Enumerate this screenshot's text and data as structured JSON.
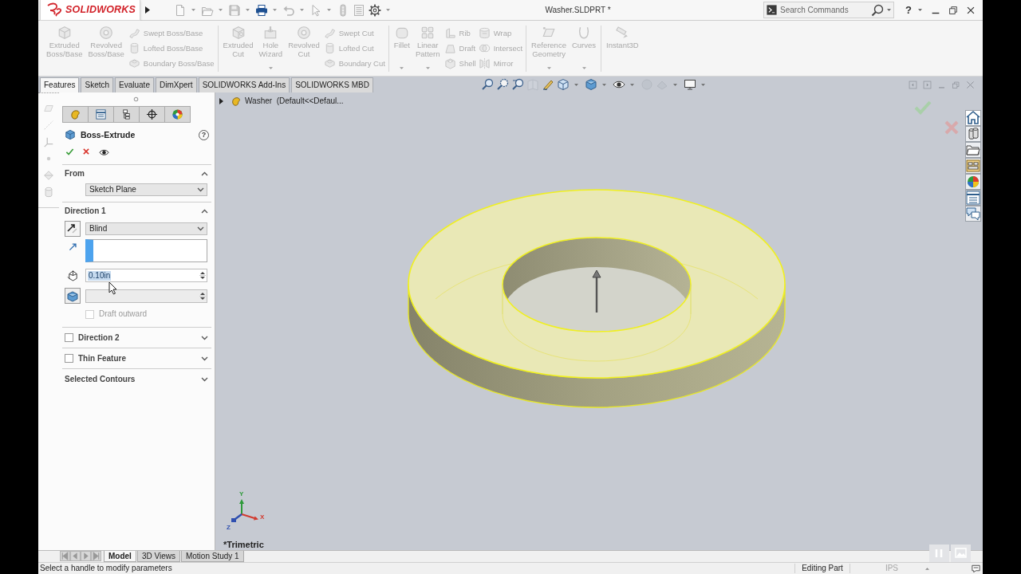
{
  "title_bar": {
    "logo": "**SOLID**WORKS",
    "document": "Washer.SLDPRT *",
    "search": {
      "placeholder": "Search Commands"
    },
    "help": "?"
  },
  "ribbon": {
    "disabled": true,
    "groups": [
      {
        "columns": [
          {
            "kind": "large",
            "label": "Extruded Boss/Base",
            "menu": false
          },
          {
            "kind": "large",
            "label": "Revolved Boss/Base",
            "menu": false
          },
          {
            "kind": "stack",
            "items": [
              "Swept Boss/Base",
              "Lofted Boss/Base",
              "Boundary Boss/Base"
            ]
          }
        ]
      },
      {
        "columns": [
          {
            "kind": "large",
            "label": "Extruded Cut",
            "menu": false
          },
          {
            "kind": "large",
            "label": "Hole Wizard",
            "menu": true
          },
          {
            "kind": "large",
            "label": "Revolved Cut",
            "menu": false
          },
          {
            "kind": "stack",
            "items": [
              "Swept Cut",
              "Lofted Cut",
              "Boundary Cut"
            ]
          }
        ]
      },
      {
        "columns": [
          {
            "kind": "large",
            "label": "Fillet",
            "menu": true
          },
          {
            "kind": "large",
            "label": "Linear Pattern",
            "menu": true
          },
          {
            "kind": "stack",
            "items": [
              "Rib",
              "Draft",
              "Shell"
            ]
          },
          {
            "kind": "stack",
            "items": [
              "Wrap",
              "Intersect",
              "Mirror"
            ]
          }
        ]
      },
      {
        "columns": [
          {
            "kind": "large",
            "label": "Reference Geometry",
            "menu": true
          },
          {
            "kind": "large",
            "label": "Curves",
            "menu": true
          }
        ]
      },
      {
        "columns": [
          {
            "kind": "large",
            "label": "Instant3D",
            "menu": false
          }
        ]
      }
    ]
  },
  "command_tabs": [
    {
      "label": "Features",
      "selected": true
    },
    {
      "label": "Sketch",
      "selected": false
    },
    {
      "label": "Evaluate",
      "selected": false
    },
    {
      "label": "DimXpert",
      "selected": false
    },
    {
      "label": "SOLIDWORKS Add-Ins",
      "selected": false
    },
    {
      "label": "SOLIDWORKS MBD",
      "selected": false
    }
  ],
  "property_manager": {
    "title": "Boss-Extrude",
    "help": "?",
    "sections": [
      {
        "kind": "select",
        "title": "From",
        "expanded": true,
        "value": "Sketch Plane"
      },
      {
        "kind": "direction",
        "title": "Direction 1",
        "expanded": true,
        "end_condition": "Blind",
        "selection": {
          "active": true
        },
        "depth": {
          "value": "0.10in",
          "highlighted": true
        },
        "draft_angle": {
          "disabled": true
        },
        "draft_outward": {
          "label": "Draft outward",
          "checked": false,
          "disabled": true
        }
      },
      {
        "kind": "toggle",
        "title": "Direction 2",
        "checked": false,
        "expanded": false
      },
      {
        "kind": "toggle",
        "title": "Thin Feature",
        "checked": false,
        "expanded": false
      },
      {
        "kind": "plain",
        "title": "Selected Contours",
        "expanded": false
      }
    ]
  },
  "viewport": {
    "tree_item": "Washer  (Default<<Defaul...",
    "view": "*Trimetric",
    "axes": [
      "X",
      "Y",
      "Z"
    ]
  },
  "model_tabs": [
    {
      "label": "Model",
      "selected": true
    },
    {
      "label": "3D Views",
      "selected": false
    },
    {
      "label": "Motion Study 1",
      "selected": false
    }
  ],
  "status_bar": {
    "message": "Select a handle to modify parameters",
    "mode": "Editing Part",
    "units": "IPS"
  }
}
